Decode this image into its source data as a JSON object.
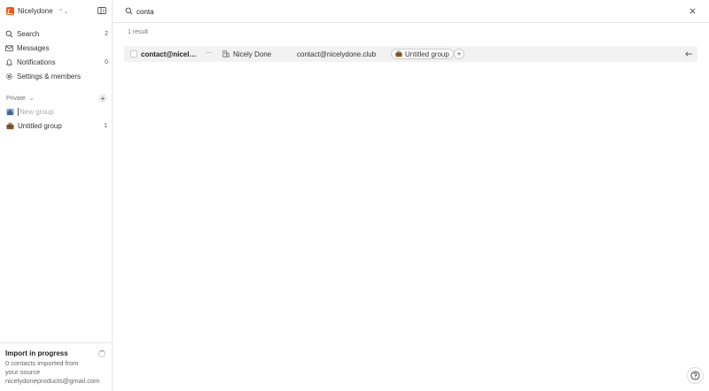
{
  "workspace": {
    "name": "Nicelydone"
  },
  "nav": [
    {
      "label": "Search",
      "count": "2",
      "icon": "search-icon"
    },
    {
      "label": "Messages",
      "count": "",
      "icon": "mail-icon"
    },
    {
      "label": "Notifications",
      "count": "0",
      "icon": "bell-icon"
    },
    {
      "label": "Settings & members",
      "count": "",
      "icon": "gear-icon"
    }
  ],
  "private_section": {
    "label": "Private"
  },
  "groups": {
    "new_placeholder": "New group",
    "items": [
      {
        "label": "Untitled group",
        "count": "1"
      }
    ]
  },
  "import": {
    "title": "Import in progress",
    "desc": "0 contacts imported from your source nicelydoneproducts@gmail.com"
  },
  "search": {
    "value": "conta"
  },
  "results": {
    "count_label": "1 result",
    "rows": [
      {
        "name": "contact@nicelydo...",
        "company": "Nicely Done",
        "email": "contact@nicelydone.club",
        "group": "Untitled group"
      }
    ]
  }
}
